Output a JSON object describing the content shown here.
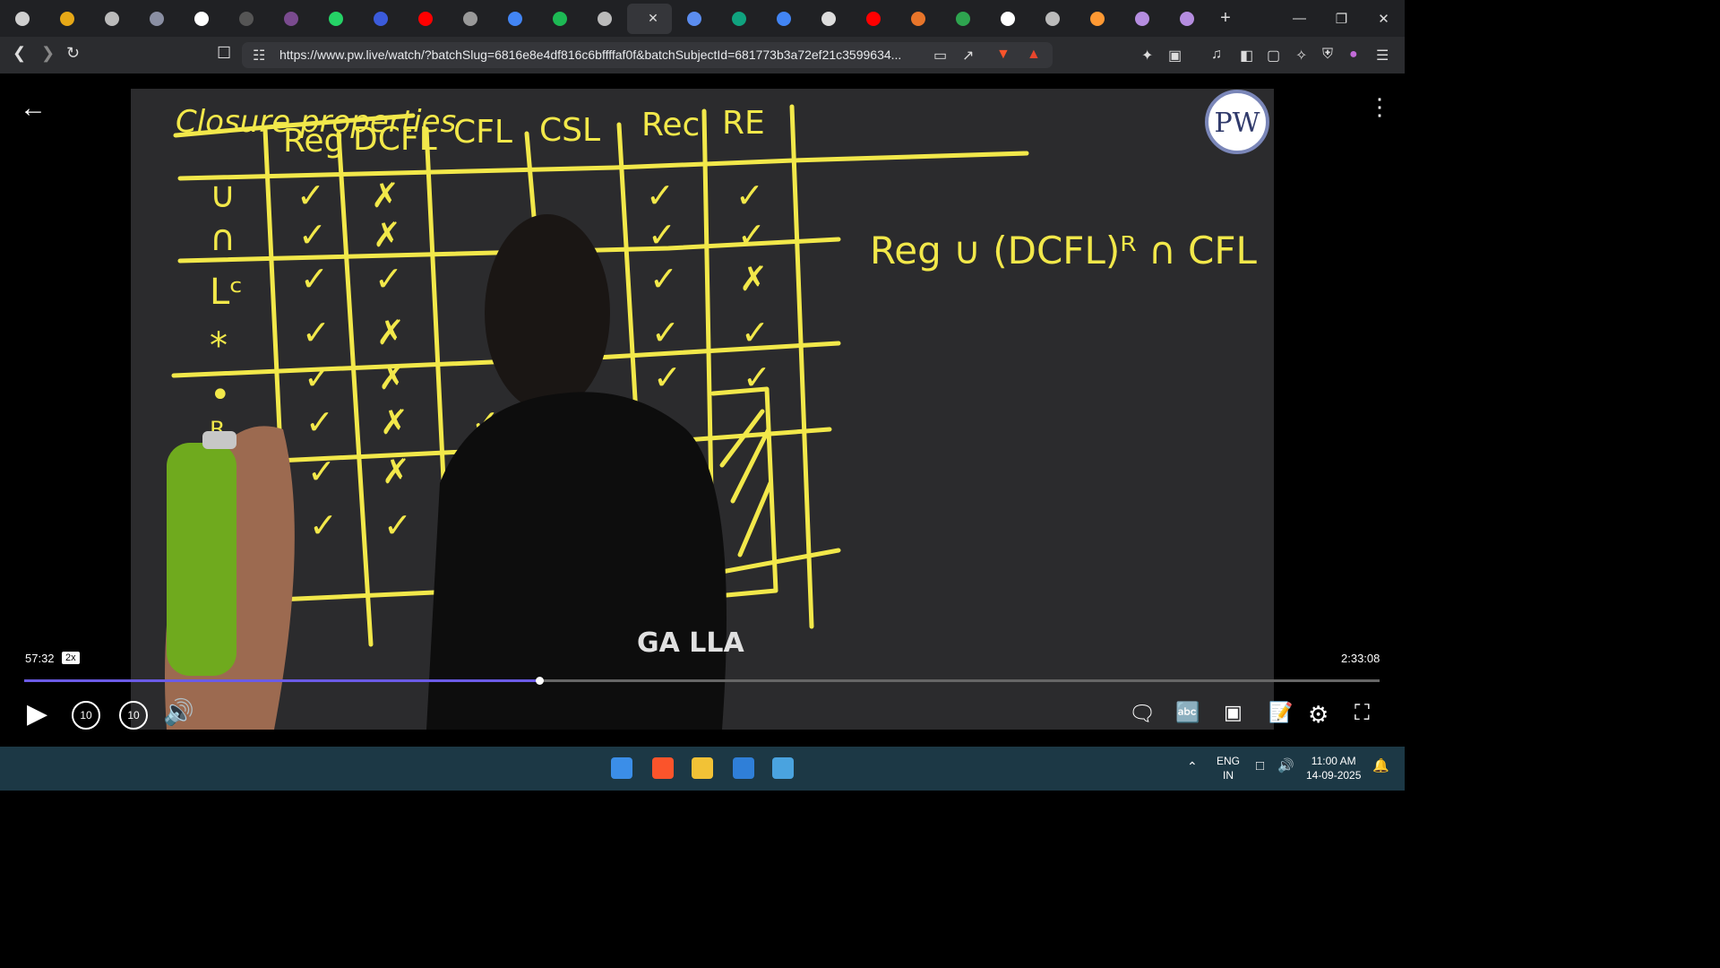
{
  "browser": {
    "url": "https://www.pw.live/watch/?batchSlug=6816e8e4df816c6bffffaf0f&batchSubjectId=681773b3a72ef21c3599634...",
    "tab_close": "✕",
    "new_tab": "+",
    "tabs": [
      {
        "icon": "chatgpt-icon",
        "color": "#cfcfcf"
      },
      {
        "icon": "coin-icon",
        "color": "#e6a817"
      },
      {
        "icon": "globe-icon",
        "color": "#bbbbbb"
      },
      {
        "icon": "site-icon",
        "color": "#8a8fa3"
      },
      {
        "icon": "wordpress-icon",
        "color": "#ffffff"
      },
      {
        "icon": "site-icon",
        "color": "#555555"
      },
      {
        "icon": "avatar-icon",
        "color": "#7a4b8f"
      },
      {
        "icon": "whatsapp-icon",
        "color": "#25d366"
      },
      {
        "icon": "bookmark-icon",
        "color": "#3b5bdb"
      },
      {
        "icon": "youtube-icon",
        "color": "#ff0000"
      },
      {
        "icon": "site-icon",
        "color": "#999999"
      },
      {
        "icon": "google-icon",
        "color": "#4285f4"
      },
      {
        "icon": "spotify-icon",
        "color": "#1db954"
      },
      {
        "icon": "globe-icon",
        "color": "#bbbbbb"
      },
      {
        "icon": "active-tab",
        "color": "#35363a"
      },
      {
        "icon": "gemini-icon",
        "color": "#5b8def"
      },
      {
        "icon": "chatgpt-icon",
        "color": "#10a37f"
      },
      {
        "icon": "google-icon",
        "color": "#4285f4"
      },
      {
        "icon": "screen-icon",
        "color": "#dddddd"
      },
      {
        "icon": "youtube-icon",
        "color": "#ff0000"
      },
      {
        "icon": "site-icon",
        "color": "#e8752a"
      },
      {
        "icon": "chart-icon",
        "color": "#2ea44f"
      },
      {
        "icon": "wikipedia-icon",
        "color": "#ffffff"
      },
      {
        "icon": "globe-icon",
        "color": "#bbbbbb"
      },
      {
        "icon": "flag-india-icon",
        "color": "#ff9933"
      },
      {
        "icon": "site-icon",
        "color": "#b58de0"
      },
      {
        "icon": "site-icon",
        "color": "#b58de0"
      }
    ]
  },
  "window_controls": {
    "minimize": "—",
    "restore": "❐",
    "close": "✕"
  },
  "player": {
    "current_time": "57:32",
    "speed": "2x",
    "duration": "2:33:08",
    "progress": 0.38,
    "seek_back": "10",
    "seek_forward": "10",
    "logo": "PW"
  },
  "board": {
    "heading": "Closure properties",
    "columns": [
      "Reg",
      "DCFL",
      "CFL",
      "CSL",
      "Rec",
      "RE"
    ],
    "rows": [
      "∪",
      "∩",
      "Lᶜ",
      "*",
      "•",
      "ᴿ"
    ],
    "expression": "Reg ∪ (DCFL)ᴿ ∩ CFL",
    "cells": [
      [
        "✓",
        "✗",
        "",
        "",
        "✓",
        "✓"
      ],
      [
        "✓",
        "✗",
        "",
        "",
        "✓",
        "✓"
      ],
      [
        "✓",
        "✓",
        "",
        "",
        "✓",
        "✗"
      ],
      [
        "✓",
        "✗",
        "",
        "",
        "✓",
        "✓"
      ],
      [
        "✓",
        "✗",
        "",
        "",
        "✓",
        "✓"
      ],
      [
        "✓",
        "✗",
        "✓",
        "",
        "",
        ""
      ],
      [
        "✓",
        "✗",
        "✓",
        "",
        "",
        ""
      ],
      [
        "✓",
        "✓",
        "",
        "",
        "",
        ""
      ]
    ],
    "shirt_text": "GA  LLA"
  },
  "taskbar": {
    "lang_top": "ENG",
    "lang_bottom": "IN",
    "clock_time": "11:00 AM",
    "clock_date": "14-09-2025"
  }
}
